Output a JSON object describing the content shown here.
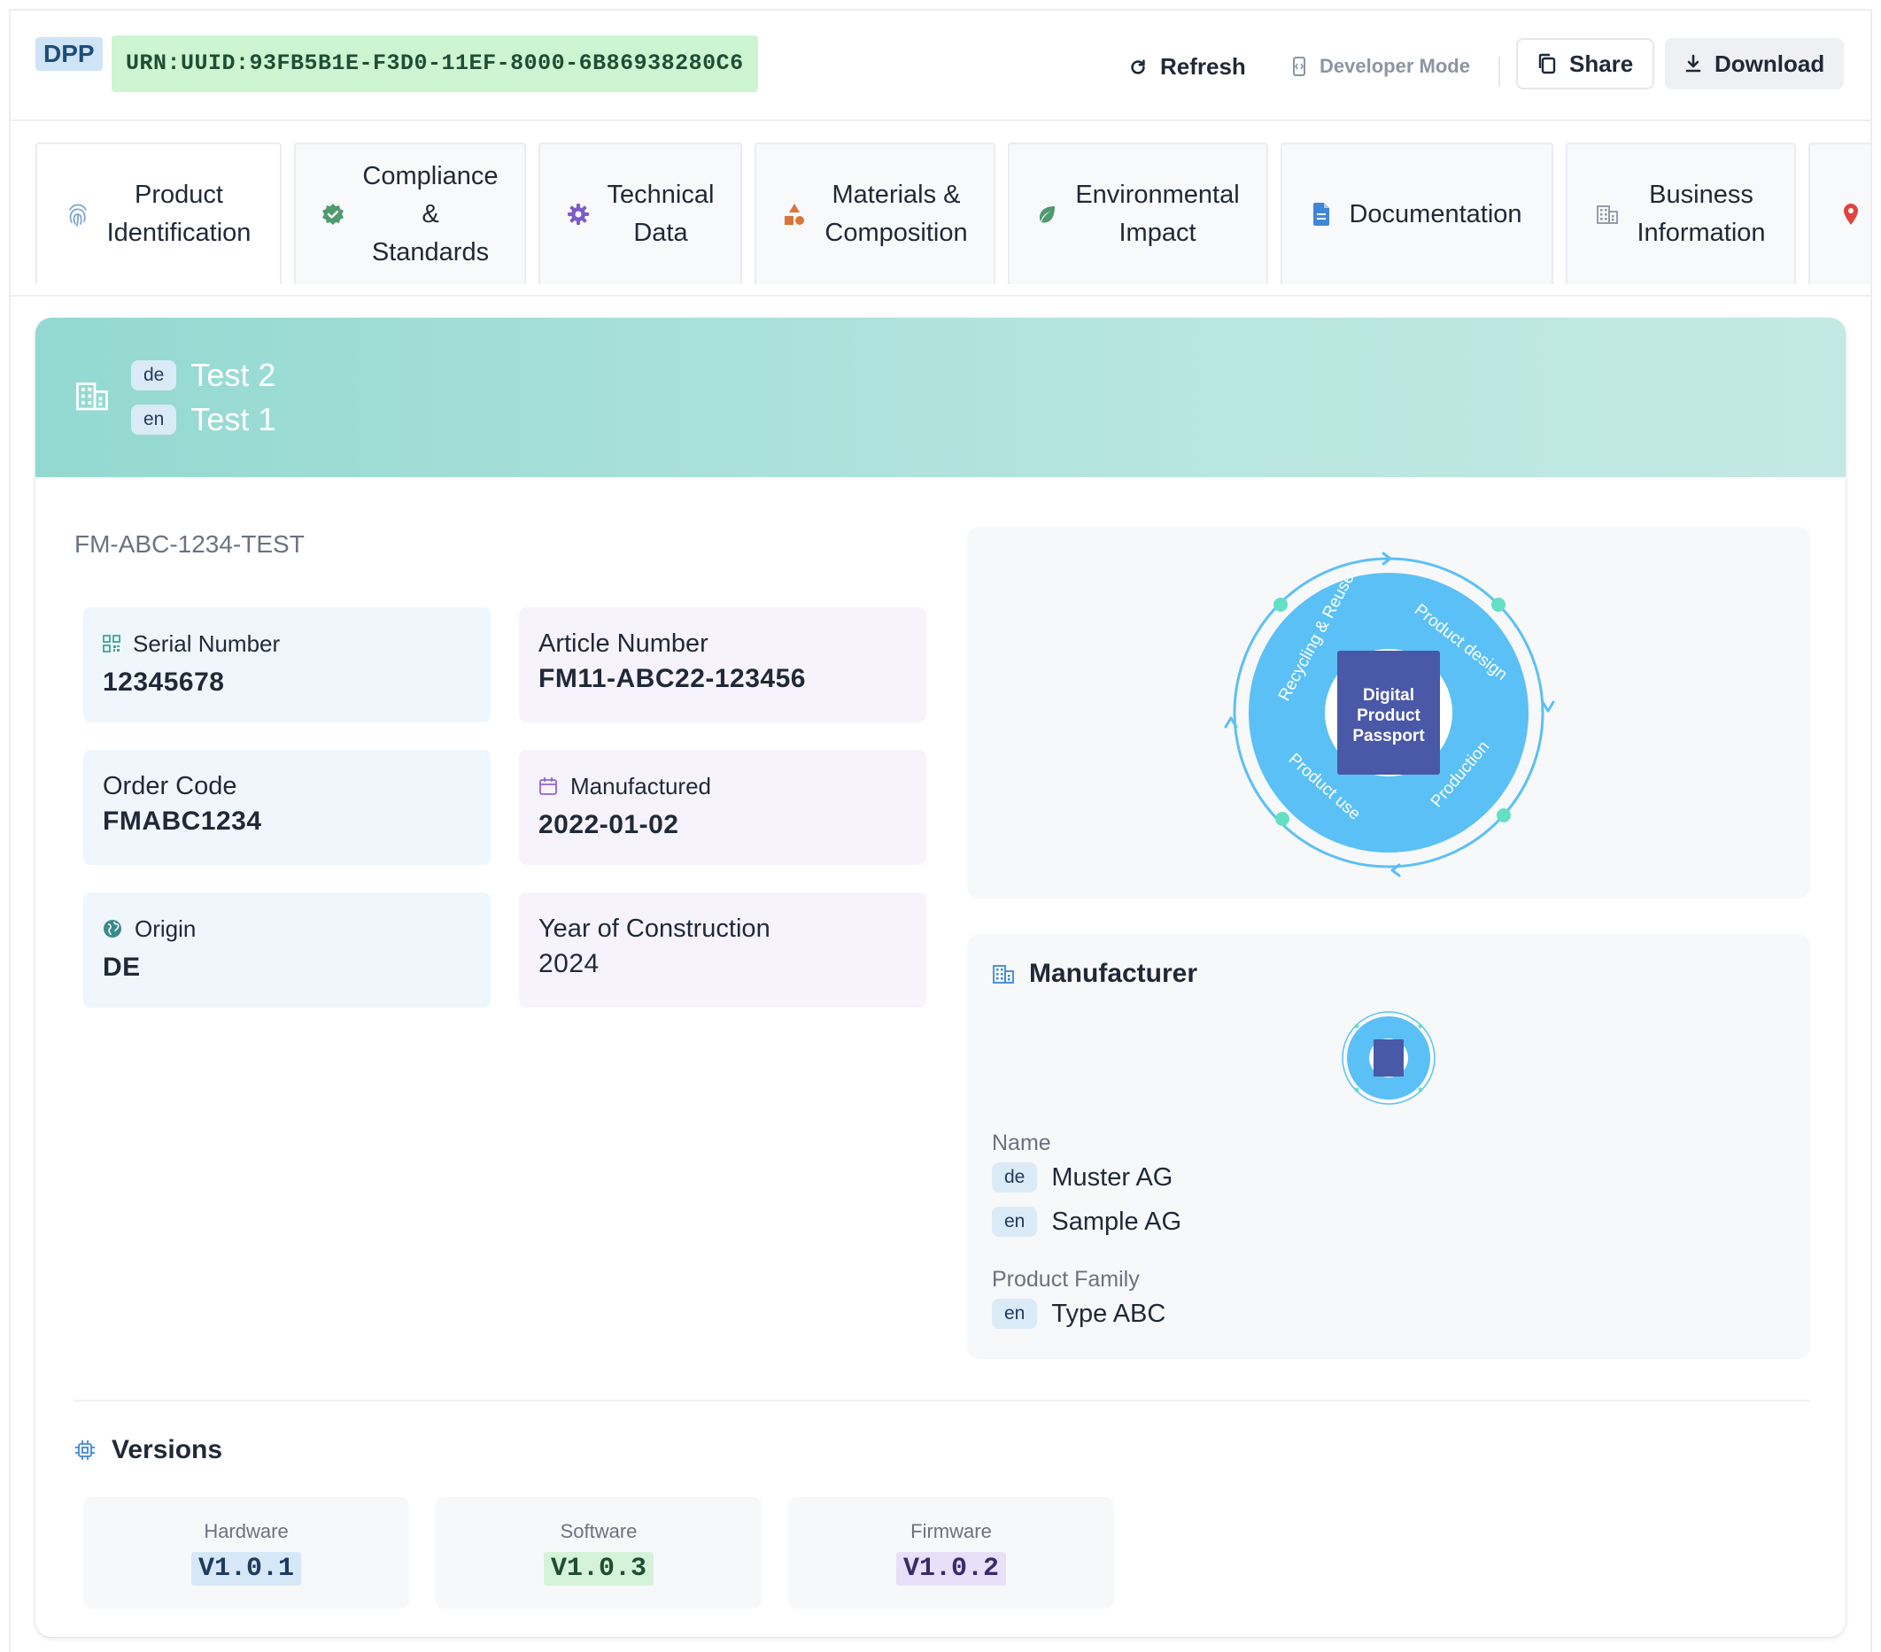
{
  "header": {
    "badge": "DPP",
    "urn": "URN:UUID:93FB5B1E-F3D0-11EF-8000-6B86938280C6",
    "refresh_label": "Refresh",
    "developer_mode_label": "Developer Mode",
    "share_label": "Share",
    "download_label": "Download"
  },
  "tabs": [
    {
      "label": "Product\nIdentification",
      "icon": "fingerprint-icon",
      "active": true
    },
    {
      "label": "Compliance\n&\nStandards",
      "icon": "check-badge-icon"
    },
    {
      "label": "Technical\nData",
      "icon": "gear-icon"
    },
    {
      "label": "Materials &\nComposition",
      "icon": "shapes-icon"
    },
    {
      "label": "Environmental\nImpact",
      "icon": "leaf-icon"
    },
    {
      "label": "Documentation",
      "icon": "document-icon"
    },
    {
      "label": "Business\nInformation",
      "icon": "building-icon"
    },
    {
      "label": "",
      "icon": "map-pin-icon"
    }
  ],
  "banner": {
    "names": [
      {
        "lang": "de",
        "text": "Test 2"
      },
      {
        "lang": "en",
        "text": "Test 1"
      }
    ]
  },
  "model_id": "FM-ABC-1234-TEST",
  "fields": {
    "serial": {
      "label": "Serial Number",
      "value": "12345678"
    },
    "article": {
      "label": "Article Number",
      "value": "FM11-ABC22-123456"
    },
    "order": {
      "label": "Order Code",
      "value": "FMABC1234"
    },
    "manufactured": {
      "label": "Manufactured",
      "value": "2022-01-02"
    },
    "origin": {
      "label": "Origin",
      "value": "DE"
    },
    "year": {
      "label": "Year of Construction",
      "value": "2024"
    }
  },
  "illustration": {
    "center": [
      "Digital",
      "Product",
      "Passport"
    ],
    "ring_labels": [
      "Recycling & Reuse",
      "Product design",
      "Production",
      "Product use"
    ]
  },
  "manufacturer": {
    "title": "Manufacturer",
    "name_label": "Name",
    "names": [
      {
        "lang": "de",
        "text": "Muster AG"
      },
      {
        "lang": "en",
        "text": "Sample AG"
      }
    ],
    "family_label": "Product Family",
    "family": [
      {
        "lang": "en",
        "text": "Type ABC"
      }
    ]
  },
  "versions": {
    "title": "Versions",
    "items": [
      {
        "label": "Hardware",
        "value": "V1.0.1",
        "color": "#d6e8f7",
        "text_color": "#1e3a5f"
      },
      {
        "label": "Software",
        "value": "V1.0.3",
        "color": "#d5f3d9",
        "text_color": "#1f4e33"
      },
      {
        "label": "Firmware",
        "value": "V1.0.2",
        "color": "#e8e0f8",
        "text_color": "#3b2a6b"
      }
    ]
  },
  "colors": {
    "accent_teal": "#93d9d1",
    "urn_bg": "#cdf5d2",
    "dpp_bg": "#cfe4f7",
    "ring_blue": "#5bc0f5",
    "passport_indigo": "#4a58a8"
  }
}
